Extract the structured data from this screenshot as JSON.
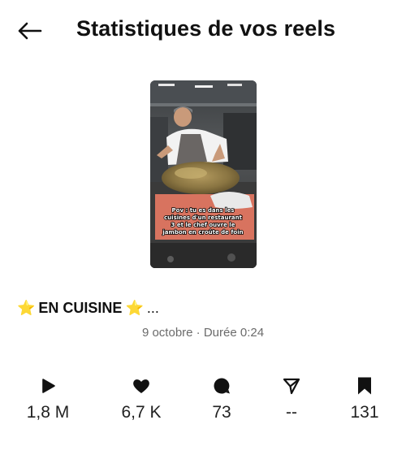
{
  "header": {
    "title": "Statistiques de vos reels",
    "back_icon": "back-arrow-icon"
  },
  "reel": {
    "overlay_text": [
      "Pov : tu es dans les",
      "cuisines d'un restaurant",
      "3      et le chef ouvre le",
      "jambon en croûte de foin"
    ]
  },
  "caption": {
    "text": "EN CUISINE",
    "ellipsis": "...",
    "emoji": "⭐",
    "emoji_color": "#f5b400"
  },
  "meta": {
    "date_duration": "9 octobre · Durée 0:24"
  },
  "stats": [
    {
      "icon": "play-icon",
      "value": "1,8 M"
    },
    {
      "icon": "heart-icon",
      "value": "6,7 K"
    },
    {
      "icon": "comment-icon",
      "value": "73"
    },
    {
      "icon": "share-icon",
      "value": "--"
    },
    {
      "icon": "bookmark-icon",
      "value": "131"
    }
  ]
}
